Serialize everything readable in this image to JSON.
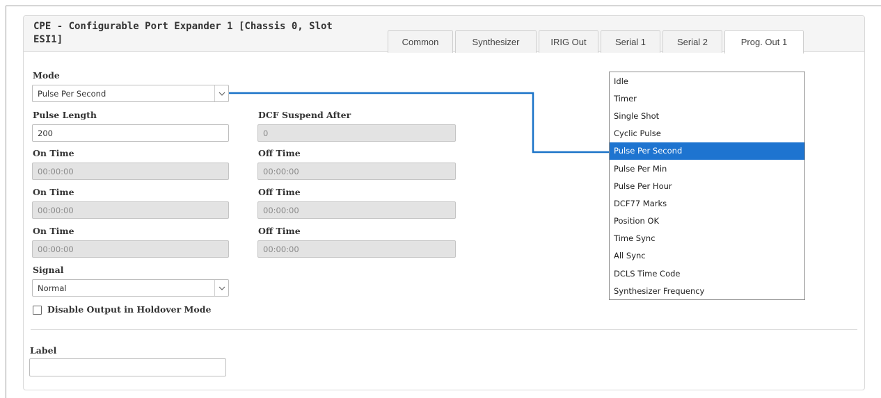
{
  "panel": {
    "title": "CPE - Configurable Port Expander 1 [Chassis 0, Slot ESI1]"
  },
  "tabs": [
    {
      "label": "Common",
      "active": false
    },
    {
      "label": "Synthesizer",
      "active": false
    },
    {
      "label": "IRIG Out",
      "active": false
    },
    {
      "label": "Serial 1",
      "active": false
    },
    {
      "label": "Serial 2",
      "active": false
    },
    {
      "label": "Prog. Out 1",
      "active": true
    }
  ],
  "form": {
    "mode_label": "Mode",
    "mode_value": "Pulse Per Second",
    "pulse_length_label": "Pulse Length",
    "pulse_length_value": "200",
    "dcf_suspend_label": "DCF Suspend After",
    "dcf_suspend_value": "0",
    "time_rows": [
      {
        "on_label": "On Time",
        "on_value": "00:00:00",
        "off_label": "Off Time",
        "off_value": "00:00:00"
      },
      {
        "on_label": "On Time",
        "on_value": "00:00:00",
        "off_label": "Off Time",
        "off_value": "00:00:00"
      },
      {
        "on_label": "On Time",
        "on_value": "00:00:00",
        "off_label": "Off Time",
        "off_value": "00:00:00"
      }
    ],
    "signal_label": "Signal",
    "signal_value": "Normal",
    "holdover_label": "Disable Output in Holdover Mode",
    "holdover_checked": false,
    "label_label": "Label",
    "label_value": ""
  },
  "mode_options": [
    "Idle",
    "Timer",
    "Single Shot",
    "Cyclic Pulse",
    "Pulse Per Second",
    "Pulse Per Min",
    "Pulse Per Hour",
    "DCF77 Marks",
    "Position OK",
    "Time Sync",
    "All Sync",
    "DCLS Time Code",
    "Synthesizer Frequency"
  ],
  "selected_option": "Pulse Per Second",
  "colors": {
    "accent": "#1e74d0",
    "connector": "#1a73c8",
    "disabled_field": "#e3e3e3"
  }
}
